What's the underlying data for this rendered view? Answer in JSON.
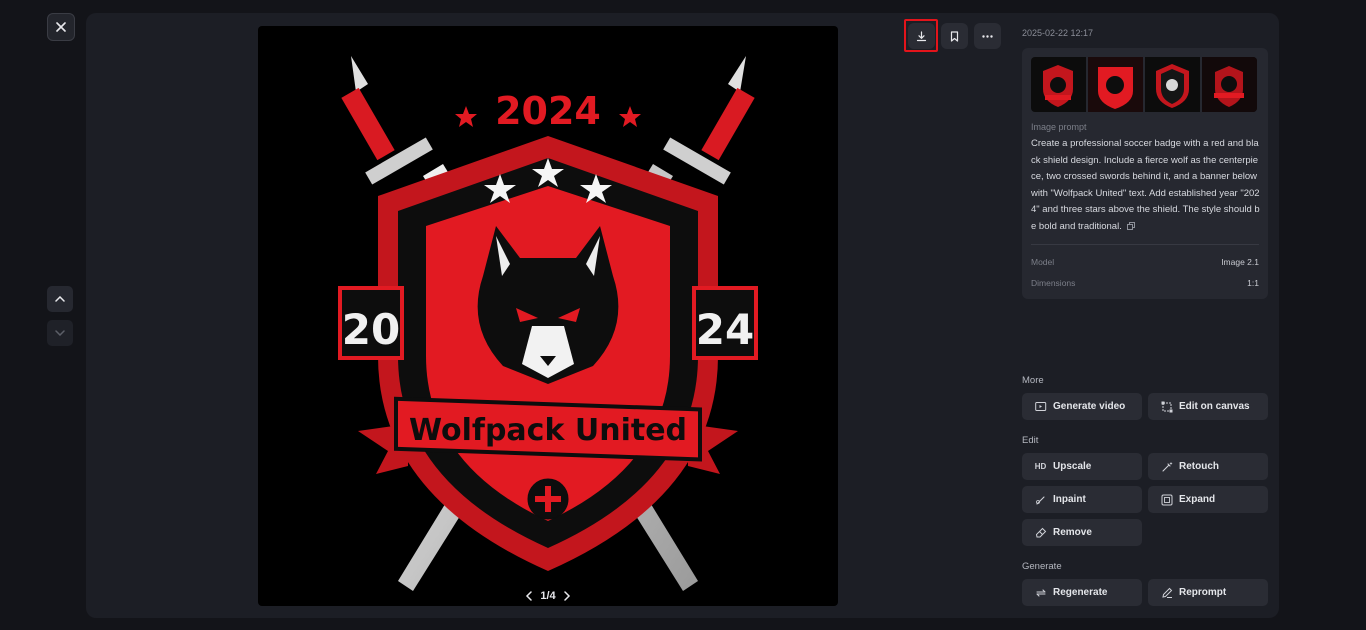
{
  "toolbar": {
    "close_icon": "close-icon",
    "prev_icon": "chevron-up-icon",
    "next_icon": "chevron-down-icon",
    "download_icon": "download-icon",
    "bookmark_icon": "bookmark-icon",
    "more_icon": "more-icon",
    "highlight_color": "#e3141b"
  },
  "image": {
    "badge_year_top": "2024",
    "badge_left_num": "20",
    "badge_right_num": "24",
    "badge_banner": "Wolfpack United",
    "pager": "1/4"
  },
  "details": {
    "timestamp": "2025-02-22 12:17",
    "prompt_label": "Image prompt",
    "prompt_text": "Create a professional soccer badge with a red and black shield design. Include a fierce wolf as the centerpiece, two crossed swords behind it, and a banner below with \"Wolfpack United\" text. Add established year \"2024\" and three stars above the shield. The style should be bold and traditional.",
    "model_label": "Model",
    "model_value": "Image 2.1",
    "dimensions_label": "Dimensions",
    "dimensions_value": "1:1"
  },
  "sections": {
    "more": "More",
    "edit": "Edit",
    "generate": "Generate"
  },
  "actions": {
    "generate_video": "Generate video",
    "edit_on_canvas": "Edit on canvas",
    "upscale": "Upscale",
    "upscale_icon_text": "HD",
    "retouch": "Retouch",
    "inpaint": "Inpaint",
    "expand": "Expand",
    "remove": "Remove",
    "regenerate": "Regenerate",
    "reprompt": "Reprompt"
  },
  "colors": {
    "background": "#131419",
    "panel": "#1c1e25",
    "card": "#262830",
    "badge_red": "#e21a22"
  }
}
